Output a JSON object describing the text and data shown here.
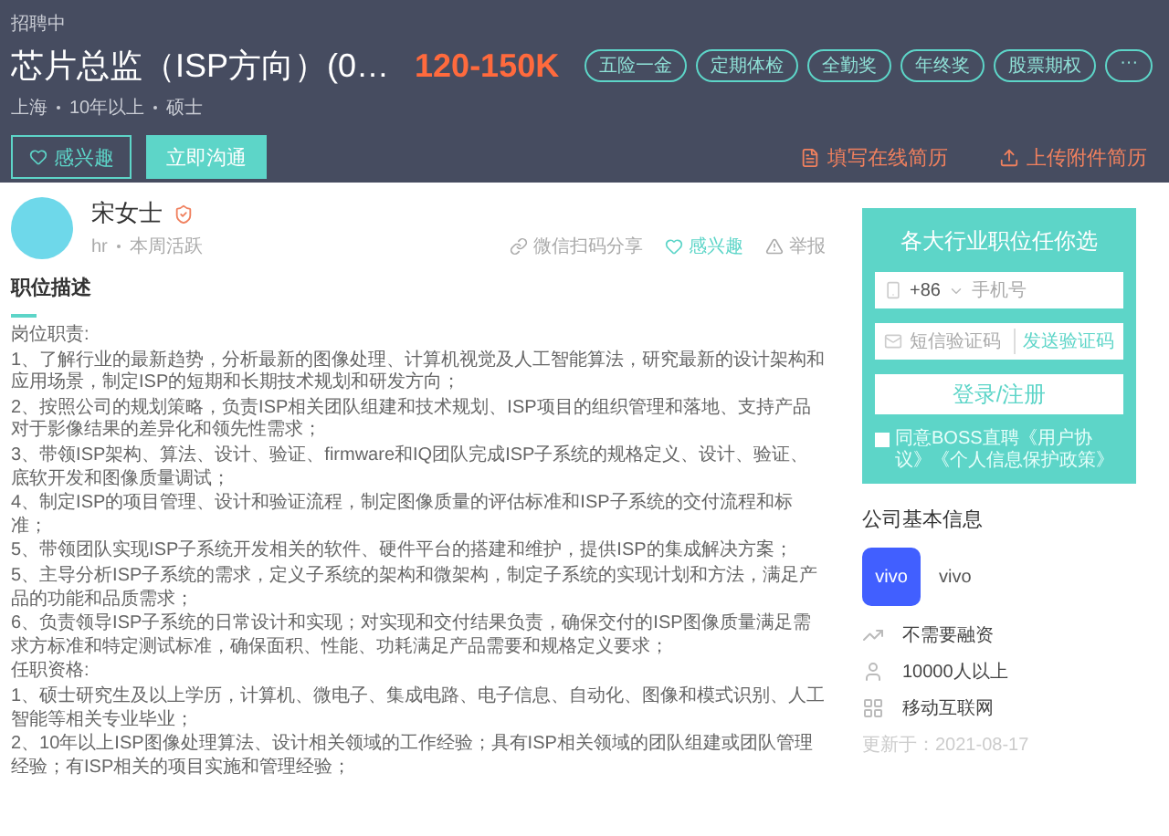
{
  "status": "招聘中",
  "job": {
    "title": "芯片总监（ISP方向）(0…",
    "salary": "120-150K",
    "meta": [
      "上海",
      "10年以上",
      "硕士"
    ]
  },
  "benefits": [
    "五险一金",
    "定期体检",
    "全勤奖",
    "年终奖",
    "股票期权",
    "···"
  ],
  "actions": {
    "interest": "感兴趣",
    "chat": "立即沟通",
    "online_resume": "填写在线简历",
    "upload_resume": "上传附件简历"
  },
  "recruiter": {
    "name": "宋女士",
    "verified": true,
    "role": "hr",
    "activity": "本周活跃"
  },
  "share_actions": [
    {
      "kind": "share",
      "label": "微信扫码分享"
    },
    {
      "kind": "interest",
      "label": "感兴趣"
    },
    {
      "kind": "report",
      "label": "举报"
    }
  ],
  "description": {
    "heading": "职位描述",
    "paragraphs": [
      "岗位职责:",
      "1、了解行业的最新趋势，分析最新的图像处理、计算机视觉及人工智能算法，研究最新的设计架构和应用场景，制定ISP的短期和长期技术规划和研发方向；",
      "2、按照公司的规划策略，负责ISP相关团队组建和技术规划、ISP项目的组织管理和落地、支持产品对于影像结果的差异化和领先性需求；",
      "3、带领ISP架构、算法、设计、验证、firmware和IQ团队完成ISP子系统的规格定义、设计、验证、底软开发和图像质量调试；",
      "4、制定ISP的项目管理、设计和验证流程，制定图像质量的评估标准和ISP子系统的交付流程和标准；",
      "5、带领团队实现ISP子系统开发相关的软件、硬件平台的搭建和维护，提供ISP的集成解决方案；",
      "5、主导分析ISP子系统的需求，定义子系统的架构和微架构，制定子系统的实现计划和方法，满足产品的功能和品质需求；",
      "6、负责领导ISP子系统的日常设计和实现；对实现和交付结果负责，确保交付的ISP图像质量满足需求方标准和特定测试标准，确保面积、性能、功耗满足产品需要和规格定义要求；",
      "任职资格:",
      "1、硕士研究生及以上学历，计算机、微电子、集成电路、电子信息、自动化、图像和模式识别、人工智能等相关专业毕业；",
      "2、10年以上ISP图像处理算法、设计相关领域的工作经验；具有ISP相关领域的团队组建或团队管理经验；有ISP相关的项目实施和管理经验；"
    ]
  },
  "login": {
    "title": "各大行业职位任你选",
    "country_code": "+86",
    "phone_placeholder": "手机号",
    "code_placeholder": "短信验证码",
    "send_code": "发送验证码",
    "submit": "登录/注册",
    "agree_checked": false,
    "agreement": "同意BOSS直聘《用户协议》《个人信息保护政策》"
  },
  "company": {
    "heading": "公司基本信息",
    "logo_text": "vivo",
    "name": "vivo",
    "facts": [
      {
        "kind": "funding",
        "label": "不需要融资"
      },
      {
        "kind": "size",
        "label": "10000人以上"
      },
      {
        "kind": "industry",
        "label": "移动互联网"
      }
    ],
    "updated": "更新于：2021-08-17"
  }
}
